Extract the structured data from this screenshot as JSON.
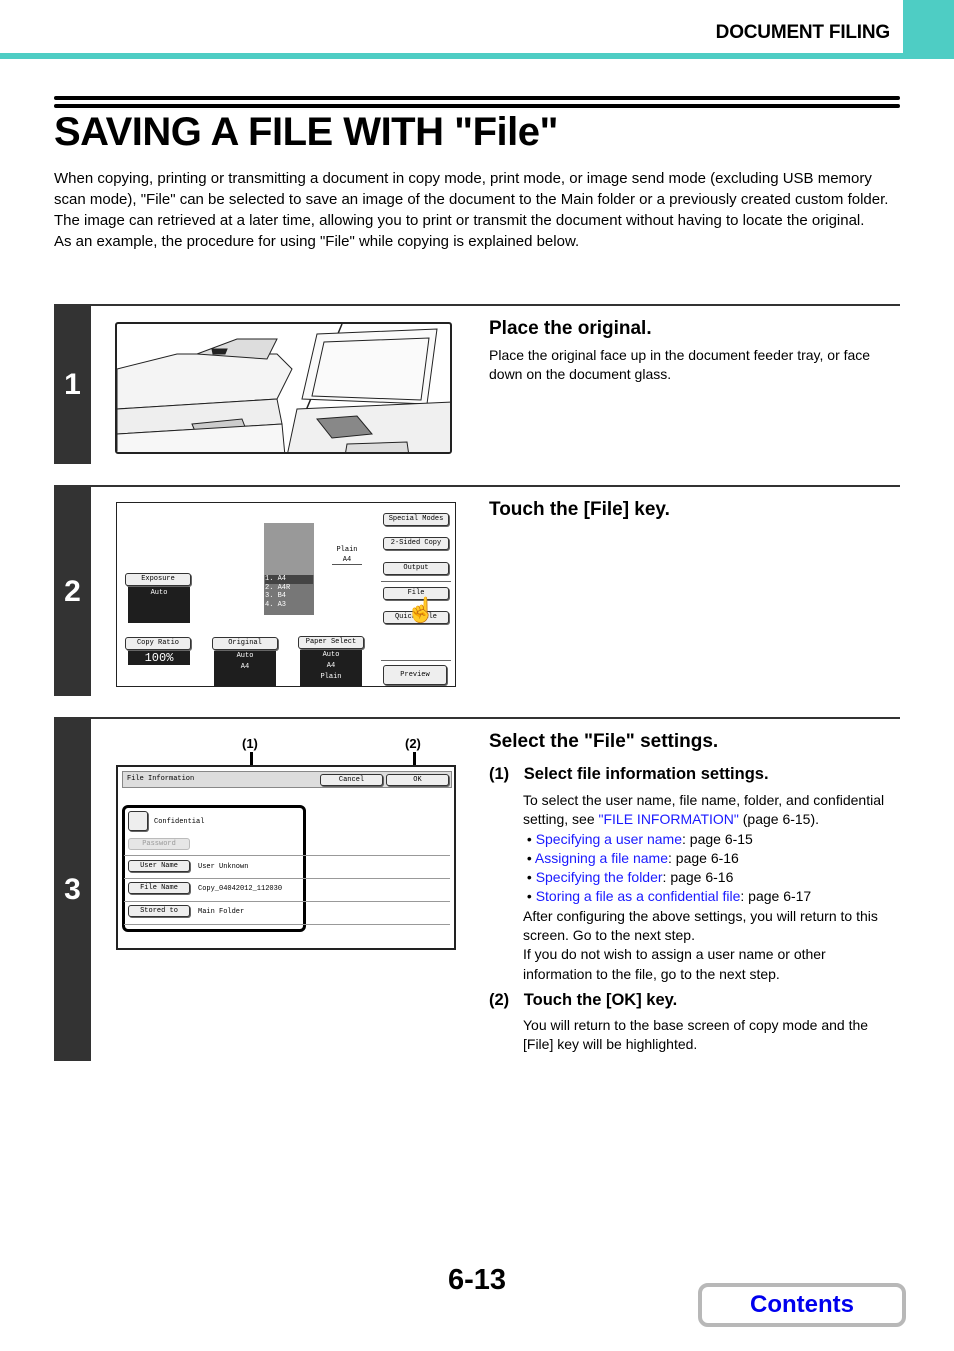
{
  "header": {
    "section": "DOCUMENT FILING"
  },
  "page": {
    "title": "SAVING A FILE WITH \"File\"",
    "intro": [
      "When copying, printing or transmitting a document in copy mode, print mode, or image send mode (excluding USB memory scan mode), \"File\" can be selected to save an image of the document to the Main folder or a previously created custom folder. The image can retrieved at a later time, allowing you to print or transmit the document without having to locate the original.",
      "As an example, the procedure for using \"File\" while copying is explained below."
    ],
    "number": "6-13",
    "contents_label": "Contents"
  },
  "steps": [
    {
      "num": "1",
      "title": "Place the original.",
      "text": "Place the original face up in the document feeder tray, or face down on the document glass."
    },
    {
      "num": "2",
      "title": "Touch the [File] key."
    },
    {
      "num": "3",
      "title": "Select the \"File\" settings.",
      "sub1": {
        "label": "(1)",
        "title": "Select file information settings.",
        "text_before": "To select the user name, file name, folder, and confidential setting, see ",
        "link": "\"FILE INFORMATION\"",
        "text_after": " (page 6-15).",
        "bullets": [
          {
            "link": "Specifying a user name",
            "page": ": page 6-15"
          },
          {
            "link": "Assigning a file name",
            "page": ": page 6-16"
          },
          {
            "link": "Specifying the folder",
            "page": ": page 6-16"
          },
          {
            "link": "Storing a file as a confidential file",
            "page": ": page 6-17"
          }
        ],
        "after1": "After configuring the above settings, you will return to this screen. Go to the next step.",
        "after2": "If you do not wish to assign a user name or other information to the file, go to the next step."
      },
      "sub2": {
        "label": "(2)",
        "title": "Touch the [OK] key.",
        "text": "You will return to the base screen of copy mode and the [File] key will be highlighted."
      }
    }
  ],
  "copy_screen": {
    "buttons": {
      "special_modes": "Special Modes",
      "two_sided": "2-Sided Copy",
      "output": "Output",
      "file": "File",
      "quick_file": "Quick File",
      "preview": "Preview"
    },
    "exposure": {
      "label": "Exposure",
      "value": "Auto"
    },
    "copy_ratio": {
      "label": "Copy Ratio",
      "value": "100%"
    },
    "original": {
      "label": "Original",
      "value": "Auto",
      "size": "A4"
    },
    "paper_select": {
      "label": "Paper Select",
      "value": "Auto",
      "size": "A4",
      "type": "Plain"
    },
    "output_tray": {
      "type": "Plain",
      "size": "A4"
    },
    "trays": [
      "1.  A4",
      "2.  A4R",
      "3.  B4",
      "4.  A3"
    ]
  },
  "file_screen": {
    "title": "File Information",
    "cancel": "Cancel",
    "ok": "OK",
    "confidential": "Confidential",
    "password": "Password",
    "rows": [
      {
        "button": "User Name",
        "value": "User Unknown"
      },
      {
        "button": "File Name",
        "value": "Copy_04042012_112030"
      },
      {
        "button": "Stored to",
        "value": "Main Folder"
      }
    ],
    "callouts": [
      "(1)",
      "(2)"
    ]
  }
}
